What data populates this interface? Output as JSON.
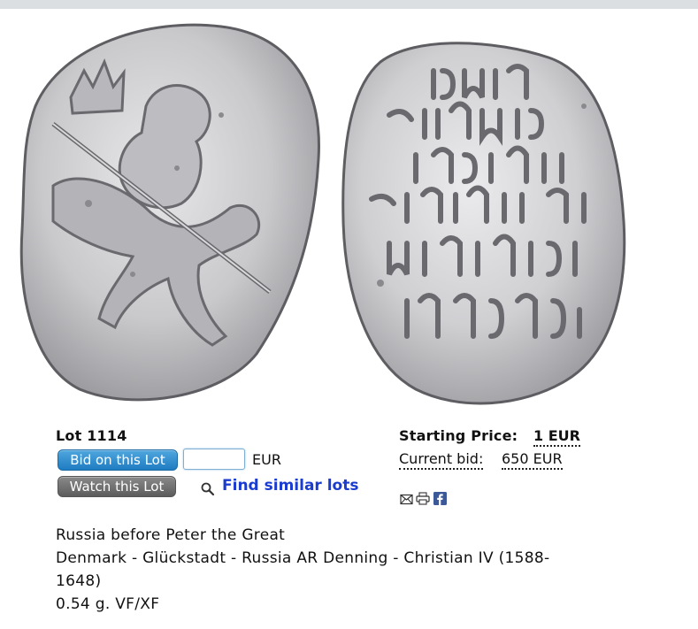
{
  "lot": {
    "label": "Lot 1114"
  },
  "actions": {
    "bid_label": "Bid on this Lot",
    "bid_input_value": "",
    "currency": "EUR",
    "watch_label": "Watch this Lot",
    "find_similar_label": "Find similar lots"
  },
  "pricing": {
    "starting_label": "Starting Price:",
    "starting_value": "1 EUR",
    "current_bid_label": "Current bid:",
    "current_bid_value": "650 EUR"
  },
  "share": {
    "icons": [
      "email-icon",
      "print-icon",
      "facebook-icon"
    ]
  },
  "description": {
    "category": "Russia before Peter the Great",
    "title_line1": "Denmark - Glückstadt - Russia AR Denning - Christian IV (1588-",
    "title_line2": "1648)",
    "details": "0.54 g. VF/XF"
  },
  "colors": {
    "bid_button": "#2a8ad0",
    "watch_button": "#6e6e6e",
    "link": "#1a3ccf",
    "facebook": "#3b5998"
  }
}
